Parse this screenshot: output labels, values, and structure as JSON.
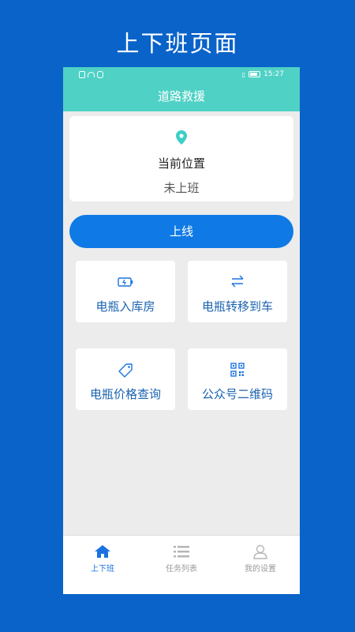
{
  "promo": {
    "title": "上下班页面"
  },
  "status_bar": {
    "time": "15:27"
  },
  "header": {
    "title": "道路救援"
  },
  "location_card": {
    "title": "当前位置",
    "status": "未上班",
    "icon": "location-pin-icon"
  },
  "online_button": {
    "label": "上线"
  },
  "tiles": [
    {
      "label": "电瓶入库房",
      "icon": "battery-icon"
    },
    {
      "label": "电瓶转移到车",
      "icon": "transfer-arrows-icon"
    },
    {
      "label": "电瓶价格查询",
      "icon": "price-tag-icon"
    },
    {
      "label": "公众号二维码",
      "icon": "qr-code-icon"
    }
  ],
  "tabbar": {
    "tabs": [
      {
        "label": "上下班",
        "icon": "home-icon",
        "active": true
      },
      {
        "label": "任务列表",
        "icon": "list-icon",
        "active": false
      },
      {
        "label": "我的设置",
        "icon": "user-icon",
        "active": false
      }
    ]
  },
  "colors": {
    "background": "#0a63c9",
    "header": "#4fd1c5",
    "accent": "#0f7ae5",
    "tile_text": "#1a63b0"
  }
}
